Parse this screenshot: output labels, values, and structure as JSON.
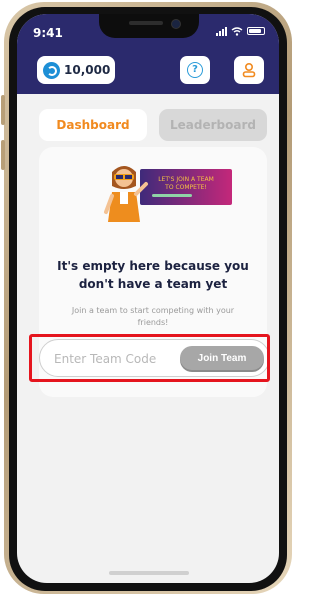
{
  "status_bar": {
    "time": "9:41"
  },
  "header": {
    "coins": "10,000",
    "coin_icon": "coin-icon",
    "help_icon": "help-icon",
    "profile_icon": "profile-icon"
  },
  "tabs": [
    {
      "label": "Dashboard",
      "active": true
    },
    {
      "label": "Leaderboard",
      "active": false
    }
  ],
  "empty_state": {
    "banner_text_line1": "LET'S JOIN A TEAM",
    "banner_text_line2": "TO COMPETE!",
    "title_line1": "It's empty here because you",
    "title_line2": "don't have a team yet",
    "subtitle": "Join a team to start competing with your friends!"
  },
  "join": {
    "placeholder": "Enter Team Code",
    "button_label": "Join Team"
  },
  "colors": {
    "header_bg": "#2b2a6d",
    "accent_orange": "#f18a1f",
    "coin_blue": "#1d8fd6",
    "highlight_red": "#e5151e"
  }
}
